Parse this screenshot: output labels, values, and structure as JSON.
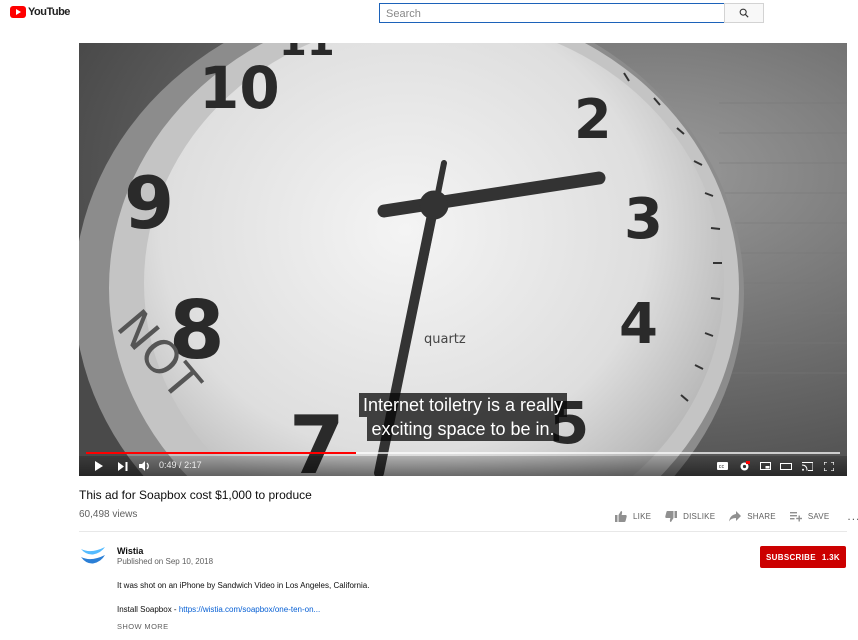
{
  "header": {
    "logo_text": "YouTube",
    "search_placeholder": "Search"
  },
  "player": {
    "captions": [
      "Internet toiletry is a really",
      "exciting space to be in."
    ],
    "clock_face_text": "quartz",
    "time_current": "0:49",
    "time_separator": "/",
    "time_total": "2:17",
    "progress_fraction": 0.358,
    "buffer_fraction": 1.0
  },
  "video": {
    "title": "This ad for Soapbox cost $1,000 to produce",
    "views": "60,498 views"
  },
  "actions": {
    "like": "LIKE",
    "dislike": "DISLIKE",
    "share": "SHARE",
    "save": "SAVE",
    "more": "..."
  },
  "channel": {
    "name": "Wistia",
    "published": "Published on Sep 10, 2018",
    "subscribe_label": "SUBSCRIBE",
    "subscriber_count": "1.3K"
  },
  "description": {
    "line1": "It was shot on an iPhone by Sandwich Video in Los Angeles, California.",
    "line2_prefix": "Install Soapbox - ",
    "line2_link": "https://wistia.com/soapbox/one-ten-on...",
    "show_more": "SHOW MORE"
  },
  "colors": {
    "brand_red": "#ff0000",
    "subscribe_red": "#cc0000",
    "link_blue": "#065fd4",
    "search_border": "#1c62b9"
  }
}
